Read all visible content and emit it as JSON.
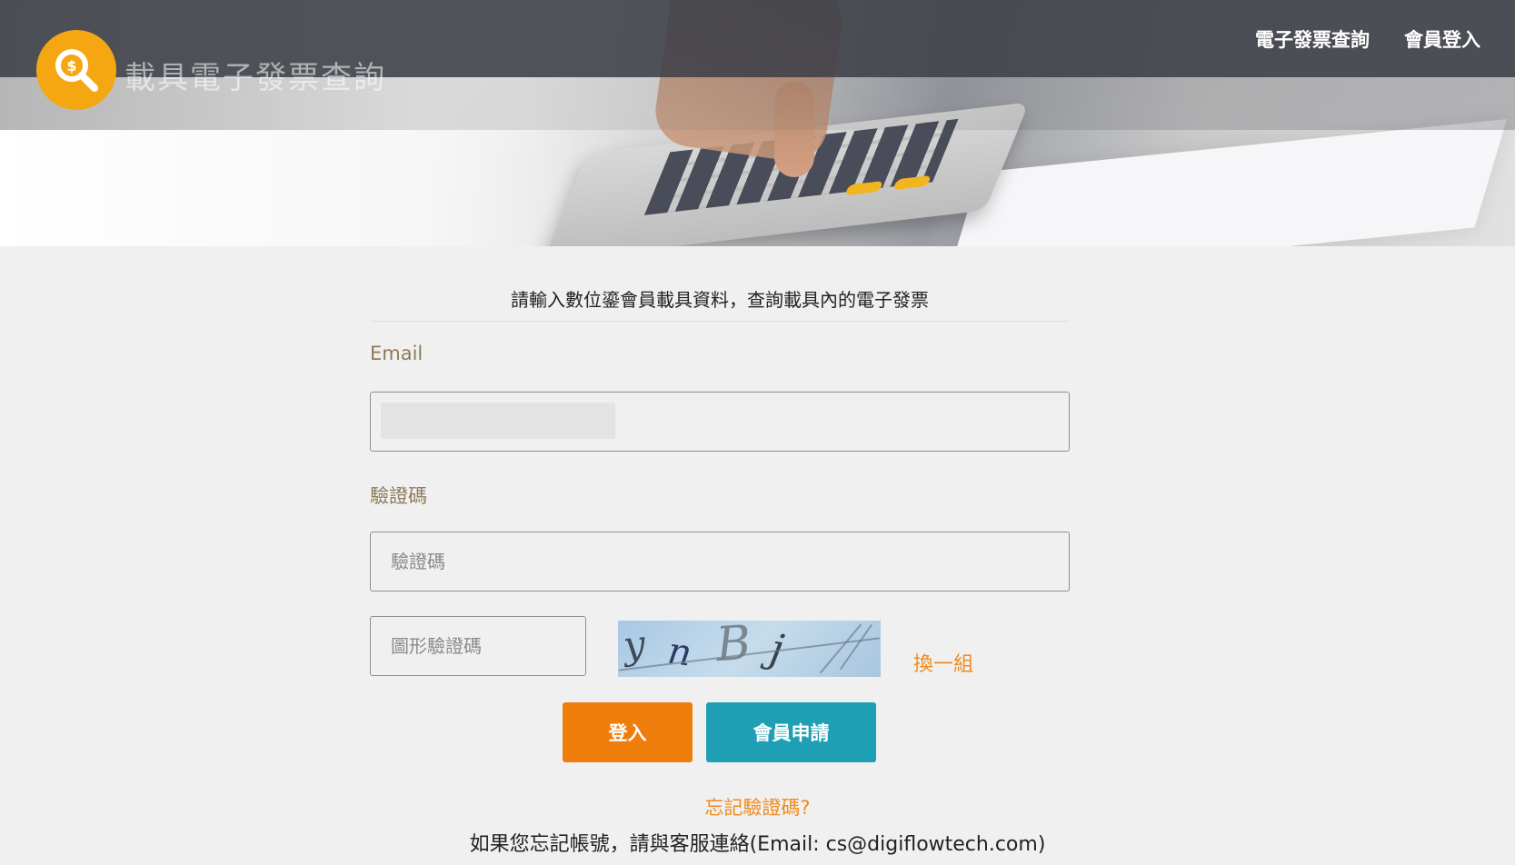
{
  "header": {
    "site_title": "載具電子發票查詢",
    "nav": [
      {
        "label": "電子發票查詢"
      },
      {
        "label": "會員登入"
      }
    ]
  },
  "form": {
    "intro": "請輸入數位鎏會員載具資料，查詢載具內的電子發票",
    "email_label": "Email",
    "code_label": "驗證碼",
    "code_placeholder": "驗證碼",
    "captcha_placeholder": "圖形驗證碼",
    "captcha_text": "ynBj",
    "refresh_label": "換一組",
    "login_button": "登入",
    "signup_button": "會員申請",
    "forgot_link": "忘記驗證碼?",
    "contact_text": "如果您忘記帳號，請與客服連絡(Email: cs@digiflowtech.com)"
  },
  "colors": {
    "accent_orange": "#ee7d0c",
    "accent_teal": "#1f9fb3",
    "label_brown": "#8f7a59",
    "logo_yellow": "#f5a711"
  },
  "icons": {
    "logo": "money-search-icon"
  }
}
